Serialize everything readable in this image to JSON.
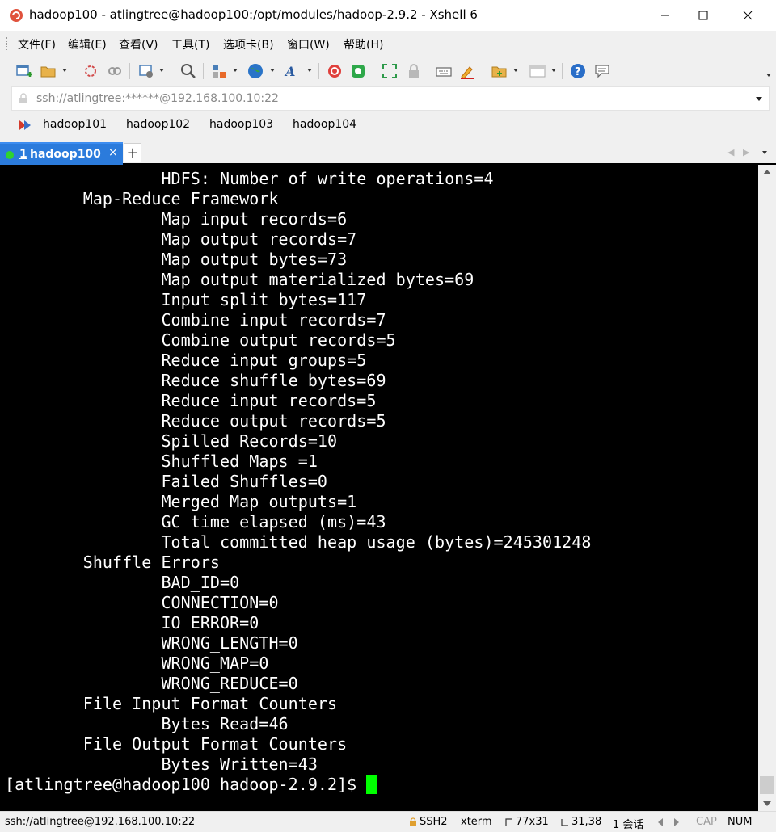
{
  "window": {
    "title": "hadoop100 - atlingtree@hadoop100:/opt/modules/hadoop-2.9.2 - Xshell 6",
    "minimize_label": "—",
    "maximize_label": "☐",
    "close_label": "✕"
  },
  "menu": [
    {
      "label": "文件(F)"
    },
    {
      "label": "编辑(E)"
    },
    {
      "label": "查看(V)"
    },
    {
      "label": "工具(T)"
    },
    {
      "label": "选项卡(B)"
    },
    {
      "label": "窗口(W)"
    },
    {
      "label": "帮助(H)"
    }
  ],
  "toolbar": {
    "icons": [
      "new-session-icon",
      "open-folder-icon",
      "disconnect-icon",
      "reconnect-icon",
      "properties-icon",
      "find-icon",
      "transfer-icon",
      "globe-icon",
      "font-icon",
      "xftp-icon",
      "xmanager-icon",
      "fullscreen-icon",
      "lock-icon",
      "keyboard-icon",
      "highlight-icon",
      "compose-icon",
      "layout-icon",
      "help-icon",
      "chat-icon"
    ]
  },
  "address": {
    "text": "ssh://atlingtree:******@192.168.100.10:22"
  },
  "links": [
    {
      "label": "hadoop101"
    },
    {
      "label": "hadoop102"
    },
    {
      "label": "hadoop103"
    },
    {
      "label": "hadoop104"
    }
  ],
  "tabs": {
    "active": {
      "number": "1",
      "name": "hadoop100",
      "close": "×"
    },
    "add": "+",
    "accent": "#2b7bdc"
  },
  "terminal": {
    "lines": [
      "                HDFS: Number of write operations=4",
      "        Map-Reduce Framework",
      "                Map input records=6",
      "                Map output records=7",
      "                Map output bytes=73",
      "                Map output materialized bytes=69",
      "                Input split bytes=117",
      "                Combine input records=7",
      "                Combine output records=5",
      "                Reduce input groups=5",
      "                Reduce shuffle bytes=69",
      "                Reduce input records=5",
      "                Reduce output records=5",
      "                Spilled Records=10",
      "                Shuffled Maps =1",
      "                Failed Shuffles=0",
      "                Merged Map outputs=1",
      "                GC time elapsed (ms)=43",
      "                Total committed heap usage (bytes)=245301248",
      "        Shuffle Errors",
      "                BAD_ID=0",
      "                CONNECTION=0",
      "                IO_ERROR=0",
      "                WRONG_LENGTH=0",
      "                WRONG_MAP=0",
      "                WRONG_REDUCE=0",
      "        File Input Format Counters",
      "                Bytes Read=46",
      "        File Output Format Counters",
      "                Bytes Written=43",
      "[atlingtree@hadoop100 hadoop-2.9.2]$ "
    ],
    "cursor_color": "#00ff00"
  },
  "status": {
    "connection": "ssh://atlingtree@192.168.100.10:22",
    "protocol": "SSH2",
    "term": "xterm",
    "size": "77x31",
    "position": "31,38",
    "sessions": "1 会话",
    "cap": "CAP",
    "num": "NUM"
  }
}
